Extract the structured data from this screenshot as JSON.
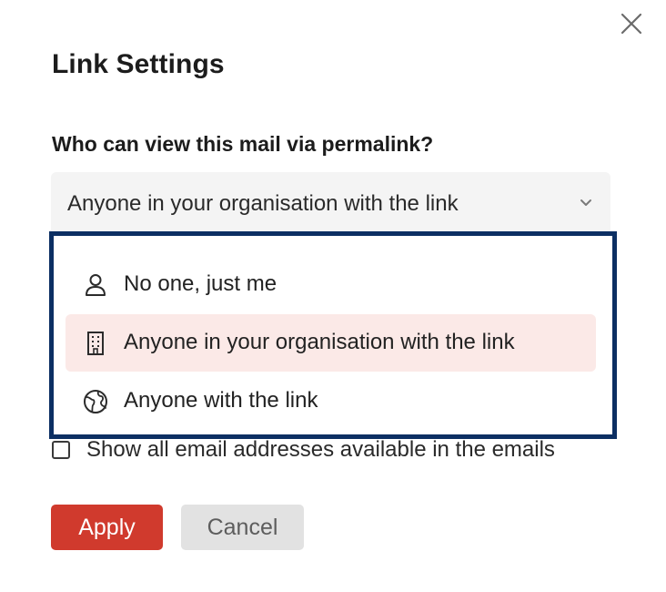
{
  "dialog": {
    "title": "Link Settings",
    "close_icon": "close-icon"
  },
  "permalink": {
    "question": "Who can view this mail via permalink?",
    "selected_value": "Anyone in your organisation with the link",
    "chevron_icon": "chevron-down-icon",
    "options": [
      {
        "label": "No one, just me",
        "icon": "user-icon",
        "selected": false
      },
      {
        "label": "Anyone in your organisation with the link",
        "icon": "building-icon",
        "selected": true
      },
      {
        "label": "Anyone with the link",
        "icon": "globe-icon",
        "selected": false
      }
    ]
  },
  "show_emails": {
    "label": "Show all email addresses available in the emails",
    "checked": false
  },
  "actions": {
    "apply_label": "Apply",
    "cancel_label": "Cancel"
  },
  "colors": {
    "primary_button": "#d03a2d",
    "secondary_button": "#e2e2e2",
    "dropdown_border": "#0c2f63",
    "selected_option_bg": "#fbe9e7",
    "select_bg": "#f4f4f4"
  }
}
